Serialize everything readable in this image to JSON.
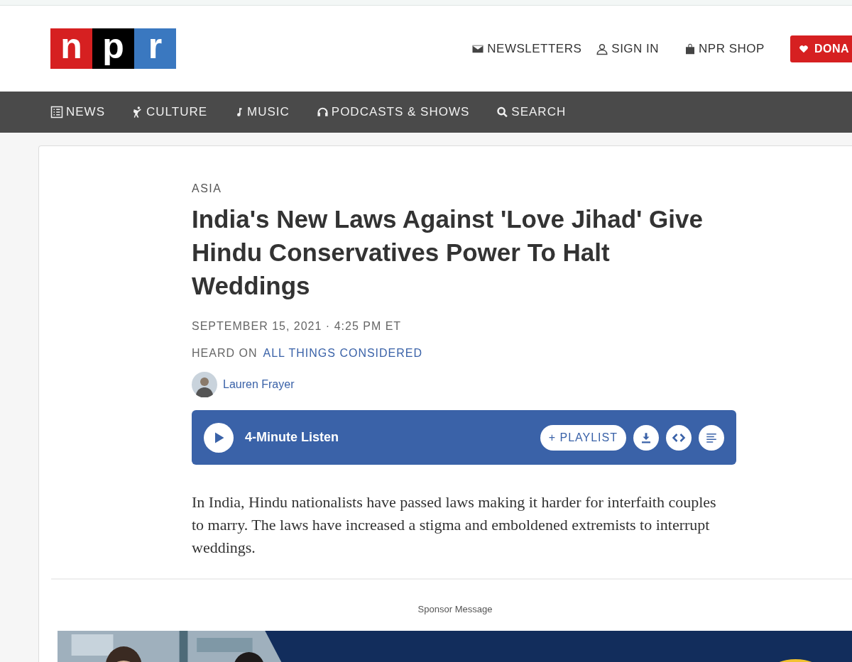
{
  "header": {
    "logo": [
      "n",
      "p",
      "r"
    ],
    "links": [
      {
        "label": "NEWSLETTERS"
      },
      {
        "label": "SIGN IN"
      },
      {
        "label": "NPR SHOP"
      }
    ],
    "donate": "DONA"
  },
  "nav": [
    {
      "label": "NEWS"
    },
    {
      "label": "CULTURE"
    },
    {
      "label": "MUSIC"
    },
    {
      "label": "PODCASTS & SHOWS"
    },
    {
      "label": "SEARCH"
    }
  ],
  "article": {
    "section": "ASIA",
    "title": "India's New Laws Against 'Love Jihad' Give Hindu Conservatives Power To Halt Weddings",
    "date": "SEPTEMBER 15, 2021 · 4:25 PM ET",
    "heard_on": "HEARD ON",
    "program": "ALL THINGS CONSIDERED",
    "author": "Lauren Frayer",
    "player": {
      "title": "4-Minute Listen",
      "playlist": "+ PLAYLIST"
    },
    "summary": "In India, Hindu nationalists have passed laws making it harder for interfaith couples to marry. The laws have increased a stigma and emboldened extremists to interrupt weddings."
  },
  "sponsor": {
    "label": "Sponsor Message"
  }
}
